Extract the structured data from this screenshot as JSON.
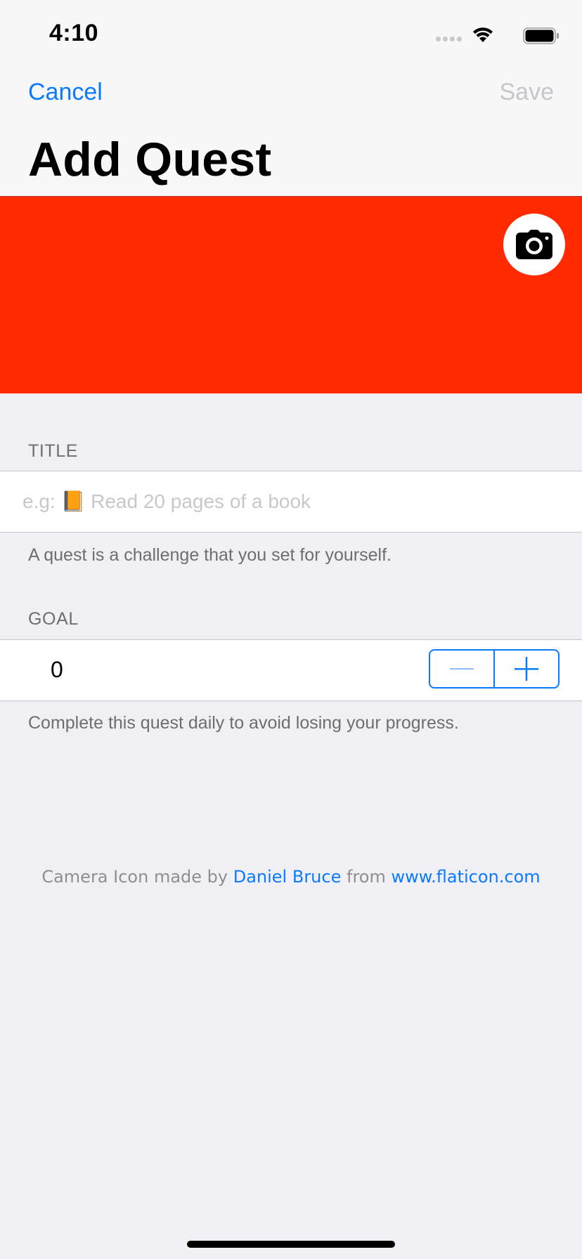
{
  "status_bar": {
    "time": "4:10"
  },
  "nav": {
    "cancel_label": "Cancel",
    "save_label": "Save",
    "title": "Add Quest"
  },
  "banner": {
    "color": "#ff2a00",
    "camera_icon": "camera-icon"
  },
  "form": {
    "title_section": {
      "header": "TITLE",
      "placeholder": "e.g: 📙 Read 20 pages of a book",
      "value": "",
      "footer": "A quest is a challenge that you set for yourself."
    },
    "goal_section": {
      "header": "GOAL",
      "value": "0",
      "footer": "Complete this quest daily to avoid losing your progress.",
      "decrement_icon": "minus-icon",
      "increment_icon": "plus-icon"
    }
  },
  "credit": {
    "prefix": "Camera Icon made by ",
    "author": "Daniel Bruce",
    "middle": " from ",
    "site": "www.flaticon.com"
  },
  "colors": {
    "accent": "#0a7afe",
    "disabled": "#c6c6cc",
    "background": "#efeff4"
  }
}
